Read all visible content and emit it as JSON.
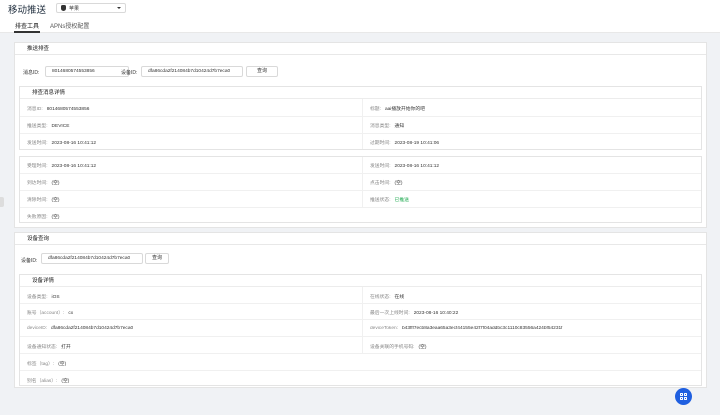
{
  "header": {
    "title": "移动推送",
    "platform": "苹果"
  },
  "tabs": [
    {
      "label": "排查工具"
    },
    {
      "label": "APNs授权配置"
    }
  ],
  "push_query": {
    "title": "推送排查",
    "message_id_label": "消息ID:",
    "message_id_value": "8014680574553856",
    "device_id_label": "设备ID:",
    "device_id_value": "dfa86cda2f214084b7d10424d7b7eca0",
    "query_button": "查询"
  },
  "message_detail": {
    "title": "排查消息详情",
    "rows": [
      [
        {
          "label": "消息ID:",
          "value": "8014680574553856"
        },
        {
          "label": "标题:",
          "value": "aai播放开始你的吧"
        }
      ],
      [
        {
          "label": "推送类型:",
          "value": "DEVICE"
        },
        {
          "label": "消息类型:",
          "value": "通知"
        }
      ],
      [
        {
          "label": "发送时间:",
          "value": "2023-08-16 10:41:12"
        },
        {
          "label": "过期时间:",
          "value": "2023-08-19 10:41:06"
        }
      ]
    ],
    "status_rows": [
      [
        {
          "label": "受理时间:",
          "value": "2023-08-16 10:41:12"
        },
        {
          "label": "发送时间:",
          "value": "2023-08-16 10:41:12"
        }
      ],
      [
        {
          "label": "到达时间:",
          "value": "(空)"
        },
        {
          "label": "点击时间:",
          "value": "(空)"
        }
      ],
      [
        {
          "label": "清除时间:",
          "value": "(空)"
        },
        {
          "label": "推送状态:",
          "value": "已推送"
        }
      ],
      [
        {
          "label": "失败原因:",
          "value": "(空)"
        }
      ]
    ]
  },
  "device_query": {
    "title": "设备查询",
    "device_id_label": "设备ID:",
    "device_id_value": "dfa86cda2f214084b7d10424d7b7eca0",
    "query_button": "查询"
  },
  "device_detail": {
    "title": "设备详情",
    "rows": [
      [
        {
          "label": "设备类型:",
          "value": "iOS"
        },
        {
          "label": "在线状态:",
          "value": "在线"
        }
      ],
      [
        {
          "label": "账号（account）:",
          "value": "cx"
        },
        {
          "label": "最后一次上线时间:",
          "value": "2023-08-16 10:40:22"
        }
      ],
      [
        {
          "label": "deviceID:",
          "value": "dfa86cda2f214084b7d10424d7b7eca0"
        },
        {
          "label": "deviceToken:",
          "value": "b43fff7ecb8a3eaa65a3ecf44155e42f7f04addbc3c1110c83556a424bf54231f"
        }
      ],
      [
        {
          "label": "设备通知状态:",
          "value": "打开"
        },
        {
          "label": "设备关联的手机号码:",
          "value": "(空)"
        }
      ],
      [
        {
          "label": "标签（tag）:",
          "value": "(空)"
        }
      ],
      [
        {
          "label": "别名（alias）:",
          "value": "(空)"
        }
      ]
    ]
  },
  "colors": {
    "accent": "#1f5fe0",
    "success": "#1da94f"
  },
  "icons": {
    "platform": "apple-icon",
    "dropdown": "chevron-down-icon",
    "fab": "grid-icon"
  }
}
